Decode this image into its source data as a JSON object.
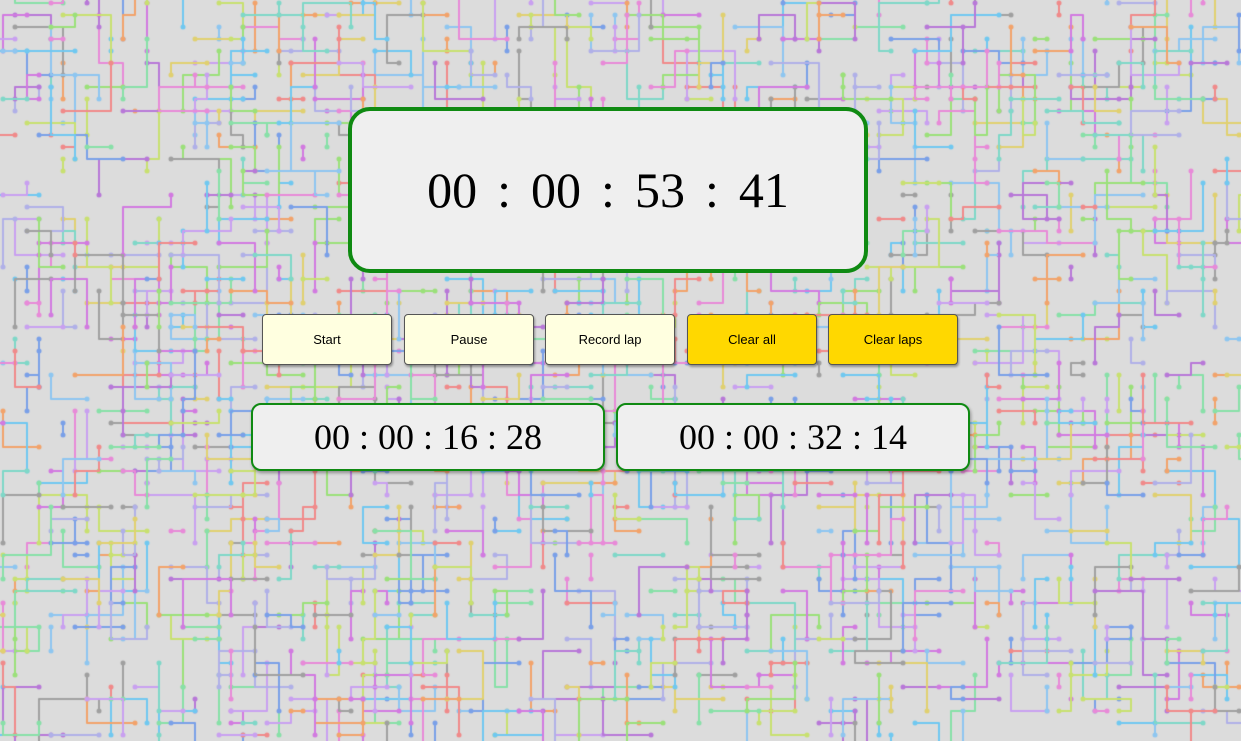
{
  "stopwatch": {
    "hours": "00",
    "minutes": "00",
    "seconds": "53",
    "hundredths": "41",
    "separator": ":"
  },
  "buttons": {
    "start": "Start",
    "pause": "Pause",
    "record_lap": "Record lap",
    "clear_all": "Clear all",
    "clear_laps": "Clear laps"
  },
  "laps": [
    "00 : 00 : 16 : 28",
    "00 : 00 : 32 : 14"
  ],
  "colors": {
    "border_green": "#0f8a12",
    "button_light": "#ffffe0",
    "button_gold": "#ffd800",
    "display_bg": "#efefef"
  }
}
